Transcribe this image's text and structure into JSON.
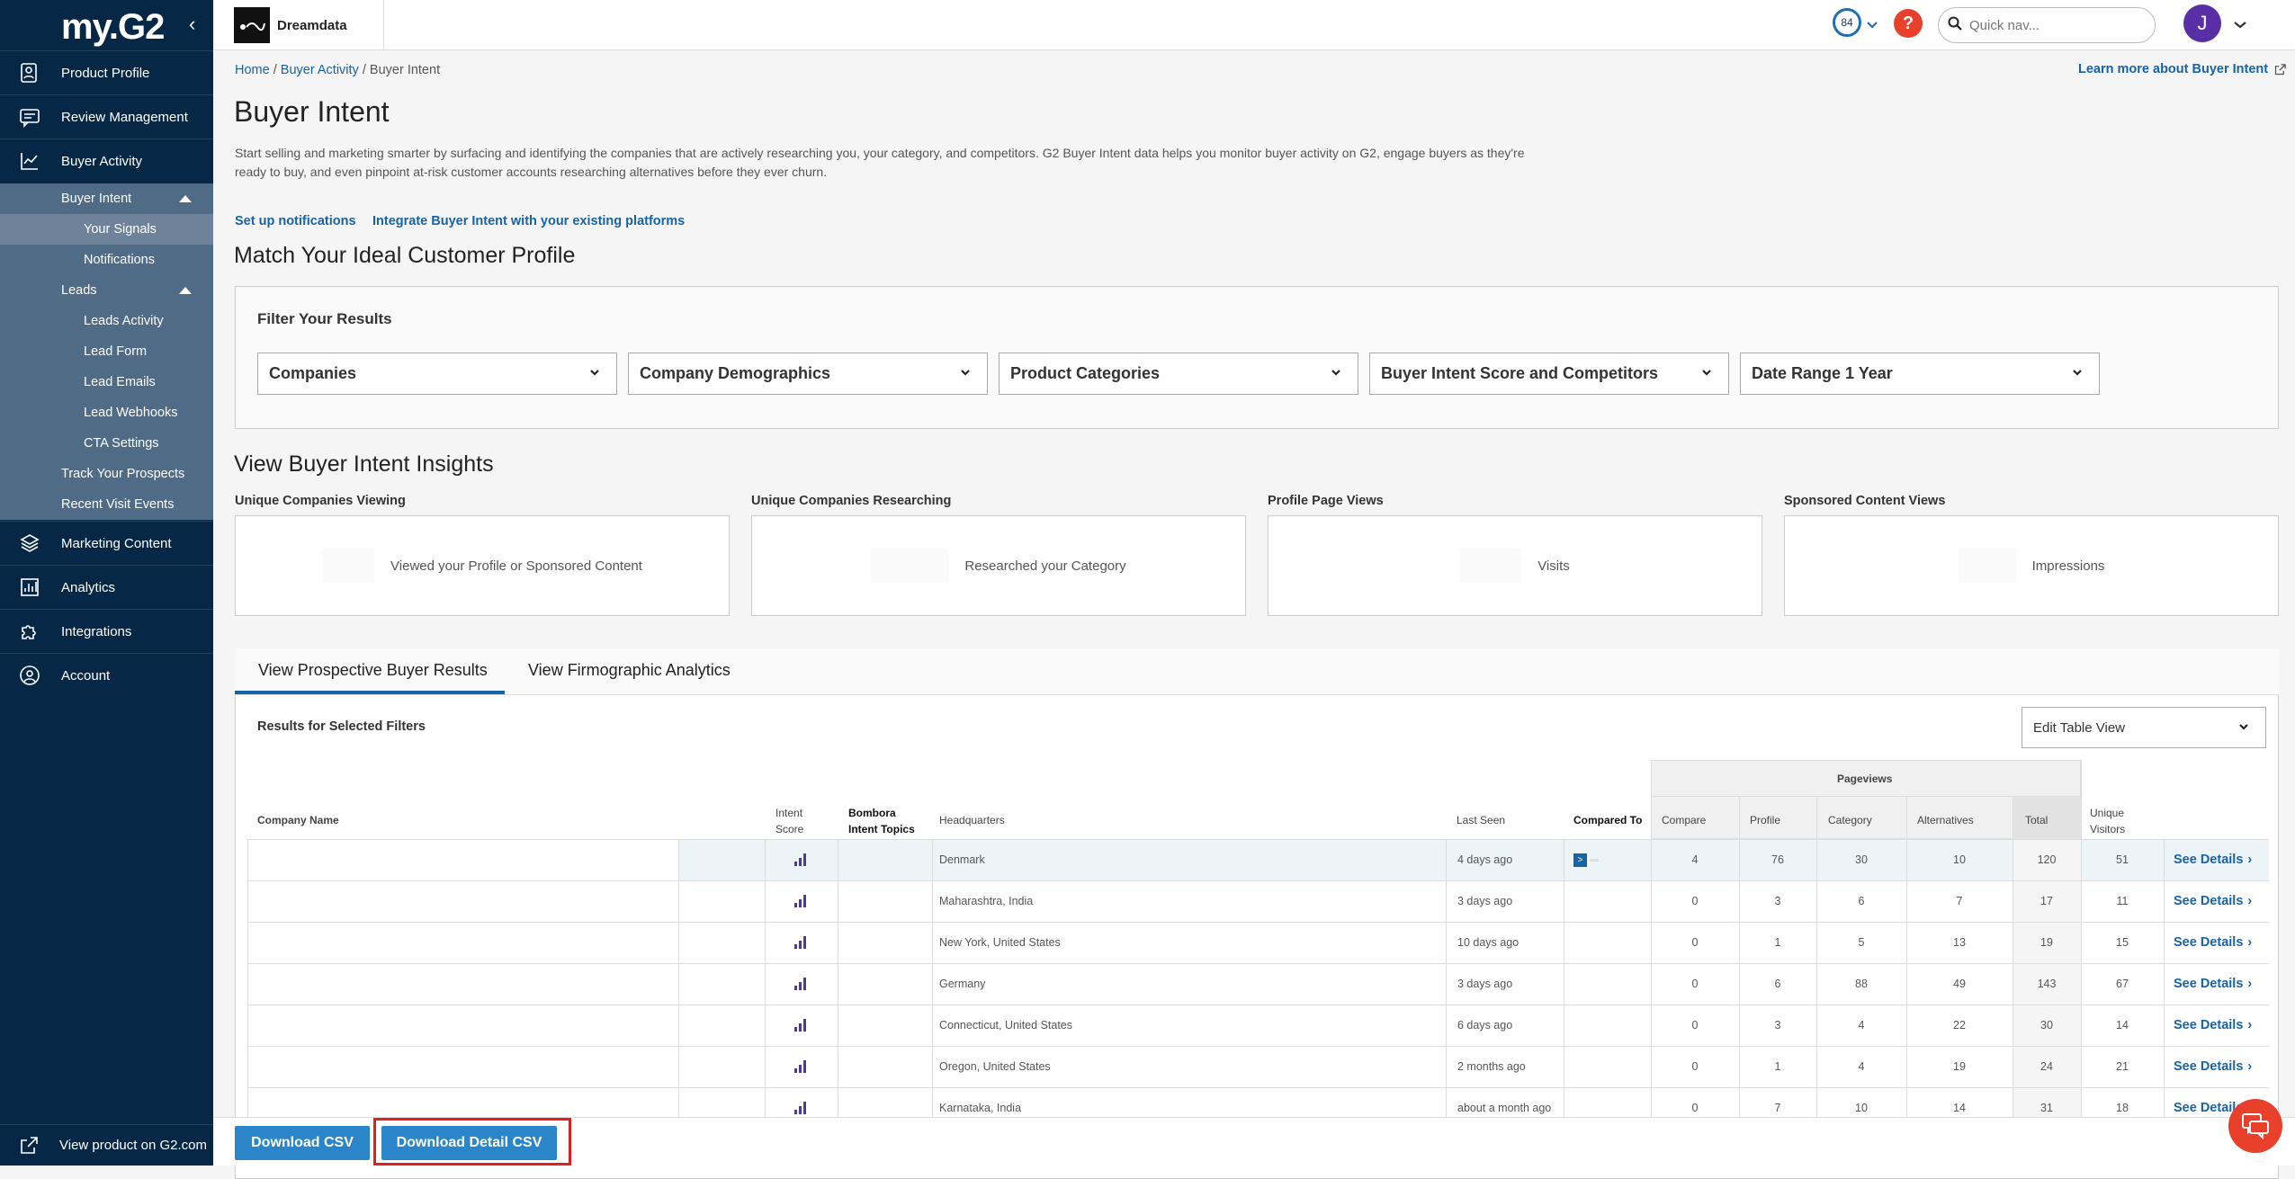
{
  "sidebar": {
    "logo": "my.G2",
    "items": [
      {
        "label": "Product Profile",
        "icon": "profile-icon"
      },
      {
        "label": "Review Management",
        "icon": "review-icon"
      },
      {
        "label": "Buyer Activity",
        "icon": "chart-line-icon"
      },
      {
        "label": "Marketing Content",
        "icon": "layers-icon"
      },
      {
        "label": "Analytics",
        "icon": "analytics-icon"
      },
      {
        "label": "Integrations",
        "icon": "puzzle-icon"
      },
      {
        "label": "Account",
        "icon": "user-circle-icon"
      }
    ],
    "subitems": {
      "buyer_intent": "Buyer Intent",
      "your_signals": "Your Signals",
      "notifications": "Notifications",
      "leads": "Leads",
      "leads_activity": "Leads Activity",
      "lead_form": "Lead Form",
      "lead_emails": "Lead Emails",
      "lead_webhooks": "Lead Webhooks",
      "cta_settings": "CTA Settings",
      "track_prospects": "Track Your Prospects",
      "recent_visits": "Recent Visit Events"
    },
    "view_product": "View product on G2.com"
  },
  "topbar": {
    "product_name": "Dreamdata",
    "score": "84",
    "help": "?",
    "search_placeholder": "Quick nav...",
    "avatar_initial": "J"
  },
  "breadcrumb": {
    "home": "Home",
    "sep1": " / ",
    "buyer_activity": "Buyer Activity",
    "sep2": " / ",
    "current": "Buyer Intent"
  },
  "learn_more": "Learn more about Buyer Intent",
  "page_title": "Buyer Intent",
  "description_line1": "Start selling and marketing smarter by surfacing and identifying the companies that are actively researching you, your category, and competitors. G2 Buyer Intent data helps you monitor buyer activity on G2, engage buyers as they're",
  "description_line2": "ready to buy, and even pinpoint at-risk customer accounts researching alternatives before they ever churn.",
  "links": {
    "setup": "Set up notifications",
    "integrate": "Integrate Buyer Intent with your existing platforms"
  },
  "match_title": "Match Your Ideal Customer Profile",
  "filter": {
    "title": "Filter Your Results",
    "dropdowns": [
      "Companies",
      "Company Demographics",
      "Product Categories",
      "Buyer Intent Score and Competitors",
      "Date Range 1 Year"
    ]
  },
  "insights": {
    "title": "View Buyer Intent Insights",
    "stats": [
      {
        "label": "Unique Companies Viewing",
        "text": "Viewed your Profile or Sponsored Content"
      },
      {
        "label": "Unique Companies Researching",
        "text": "Researched your Category"
      },
      {
        "label": "Profile Page Views",
        "text": "Visits"
      },
      {
        "label": "Sponsored Content Views",
        "text": "Impressions"
      }
    ]
  },
  "tabs": [
    "View Prospective Buyer Results",
    "View Firmographic Analytics"
  ],
  "results_label": "Results for Selected Filters",
  "edit_table": "Edit Table View",
  "table": {
    "headers": {
      "company": "Company Name",
      "intent1": "Intent",
      "intent2": "Score",
      "bombora1": "Bombora",
      "bombora2": "Intent Topics",
      "hq": "Headquarters",
      "last_seen": "Last Seen",
      "compared": "Compared To",
      "pageviews": "Pageviews",
      "compare": "Compare",
      "profile": "Profile",
      "category": "Category",
      "alternatives": "Alternatives",
      "total": "Total",
      "unique1": "Unique",
      "unique2": "Visitors"
    },
    "see_details": "See Details",
    "rows": [
      {
        "hq": "Denmark",
        "last_seen": "4 days ago",
        "compare": "4",
        "profile": "76",
        "category": "30",
        "alternatives": "10",
        "total": "120",
        "unique": "51"
      },
      {
        "hq": "Maharashtra, India",
        "last_seen": "3 days ago",
        "compare": "0",
        "profile": "3",
        "category": "6",
        "alternatives": "7",
        "total": "17",
        "unique": "11"
      },
      {
        "hq": "New York, United States",
        "last_seen": "10 days ago",
        "compare": "0",
        "profile": "1",
        "category": "5",
        "alternatives": "13",
        "total": "19",
        "unique": "15"
      },
      {
        "hq": "Germany",
        "last_seen": "3 days ago",
        "compare": "0",
        "profile": "6",
        "category": "88",
        "alternatives": "49",
        "total": "143",
        "unique": "67"
      },
      {
        "hq": "Connecticut, United States",
        "last_seen": "6 days ago",
        "compare": "0",
        "profile": "3",
        "category": "4",
        "alternatives": "22",
        "total": "30",
        "unique": "14"
      },
      {
        "hq": "Oregon, United States",
        "last_seen": "2 months ago",
        "compare": "0",
        "profile": "1",
        "category": "4",
        "alternatives": "19",
        "total": "24",
        "unique": "21"
      },
      {
        "hq": "Karnataka, India",
        "last_seen": "about a month ago",
        "compare": "0",
        "profile": "7",
        "category": "10",
        "alternatives": "14",
        "total": "31",
        "unique": "18"
      }
    ]
  },
  "buttons": {
    "download_csv": "Download CSV",
    "download_detail_csv": "Download Detail CSV"
  },
  "colors": {
    "sidebar_bg": "#062846",
    "link": "#1763a6",
    "button": "#2a86c9",
    "highlight": "#e02020",
    "chat": "#e8402a"
  }
}
